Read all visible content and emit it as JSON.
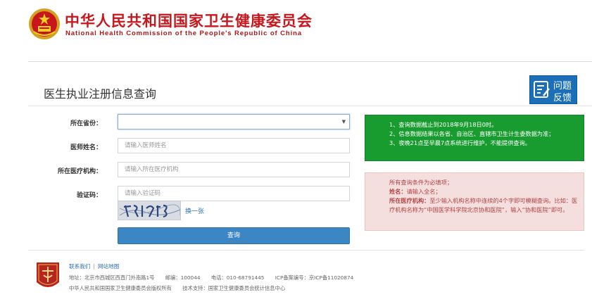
{
  "header": {
    "title_cn": "中华人民共和国国家卫生健康委员会",
    "title_en": "National Health Commission of the People's Republic of China"
  },
  "page": {
    "title": "医生执业注册信息查询",
    "help_line1": "问题",
    "help_line2": "反馈"
  },
  "form": {
    "province_label": "所在省份：",
    "province_value": "",
    "name_label": "医师姓名：",
    "name_placeholder": "请输入医师姓名",
    "org_label": "所在医疗机构：",
    "org_placeholder": "请输入所在医疗机构",
    "captcha_label": "验证码：",
    "captcha_placeholder": "请输入验证码",
    "captcha_refresh": "换一张",
    "submit": "查询"
  },
  "notice_green": [
    "1、查询数据截止到2018年9月18日0时。",
    "2、信息数据结果以各省、自治区、直辖市卫生计生委数据为准；",
    "3、夜晚21点至早晨7点系统进行维护，不能提供查询。"
  ],
  "notice_red": {
    "intro": "所有查询条件为必填项；",
    "name_key": "姓名：",
    "name_val": "请输入全名；",
    "org_key": "所在医疗机构：",
    "org_val": "至少输入机构名称中连续的4个字即可模糊查询。比如：医疗机构名称为“中国医学科学院北京协和医院”，输入“协和医院”即可。"
  },
  "footer": {
    "link_contact": "联系我们",
    "link_sitemap": "网站地图",
    "address": "地址：北京市西城区西直门外南路1号",
    "postcode": "邮编：100044",
    "phone": "电话：010-68791445",
    "icp": "ICP备案编号：京ICP备11020874",
    "copyright": "中华人民共和国国家卫生健康委员会版权所有",
    "support": "技术支持：国家卫生健康委员会统计信息中心"
  },
  "colors": {
    "brand_red": "#c8161d",
    "notice_green": "#189b2f",
    "notice_red_bg": "#f5dede",
    "button_blue": "#3c86c4"
  }
}
